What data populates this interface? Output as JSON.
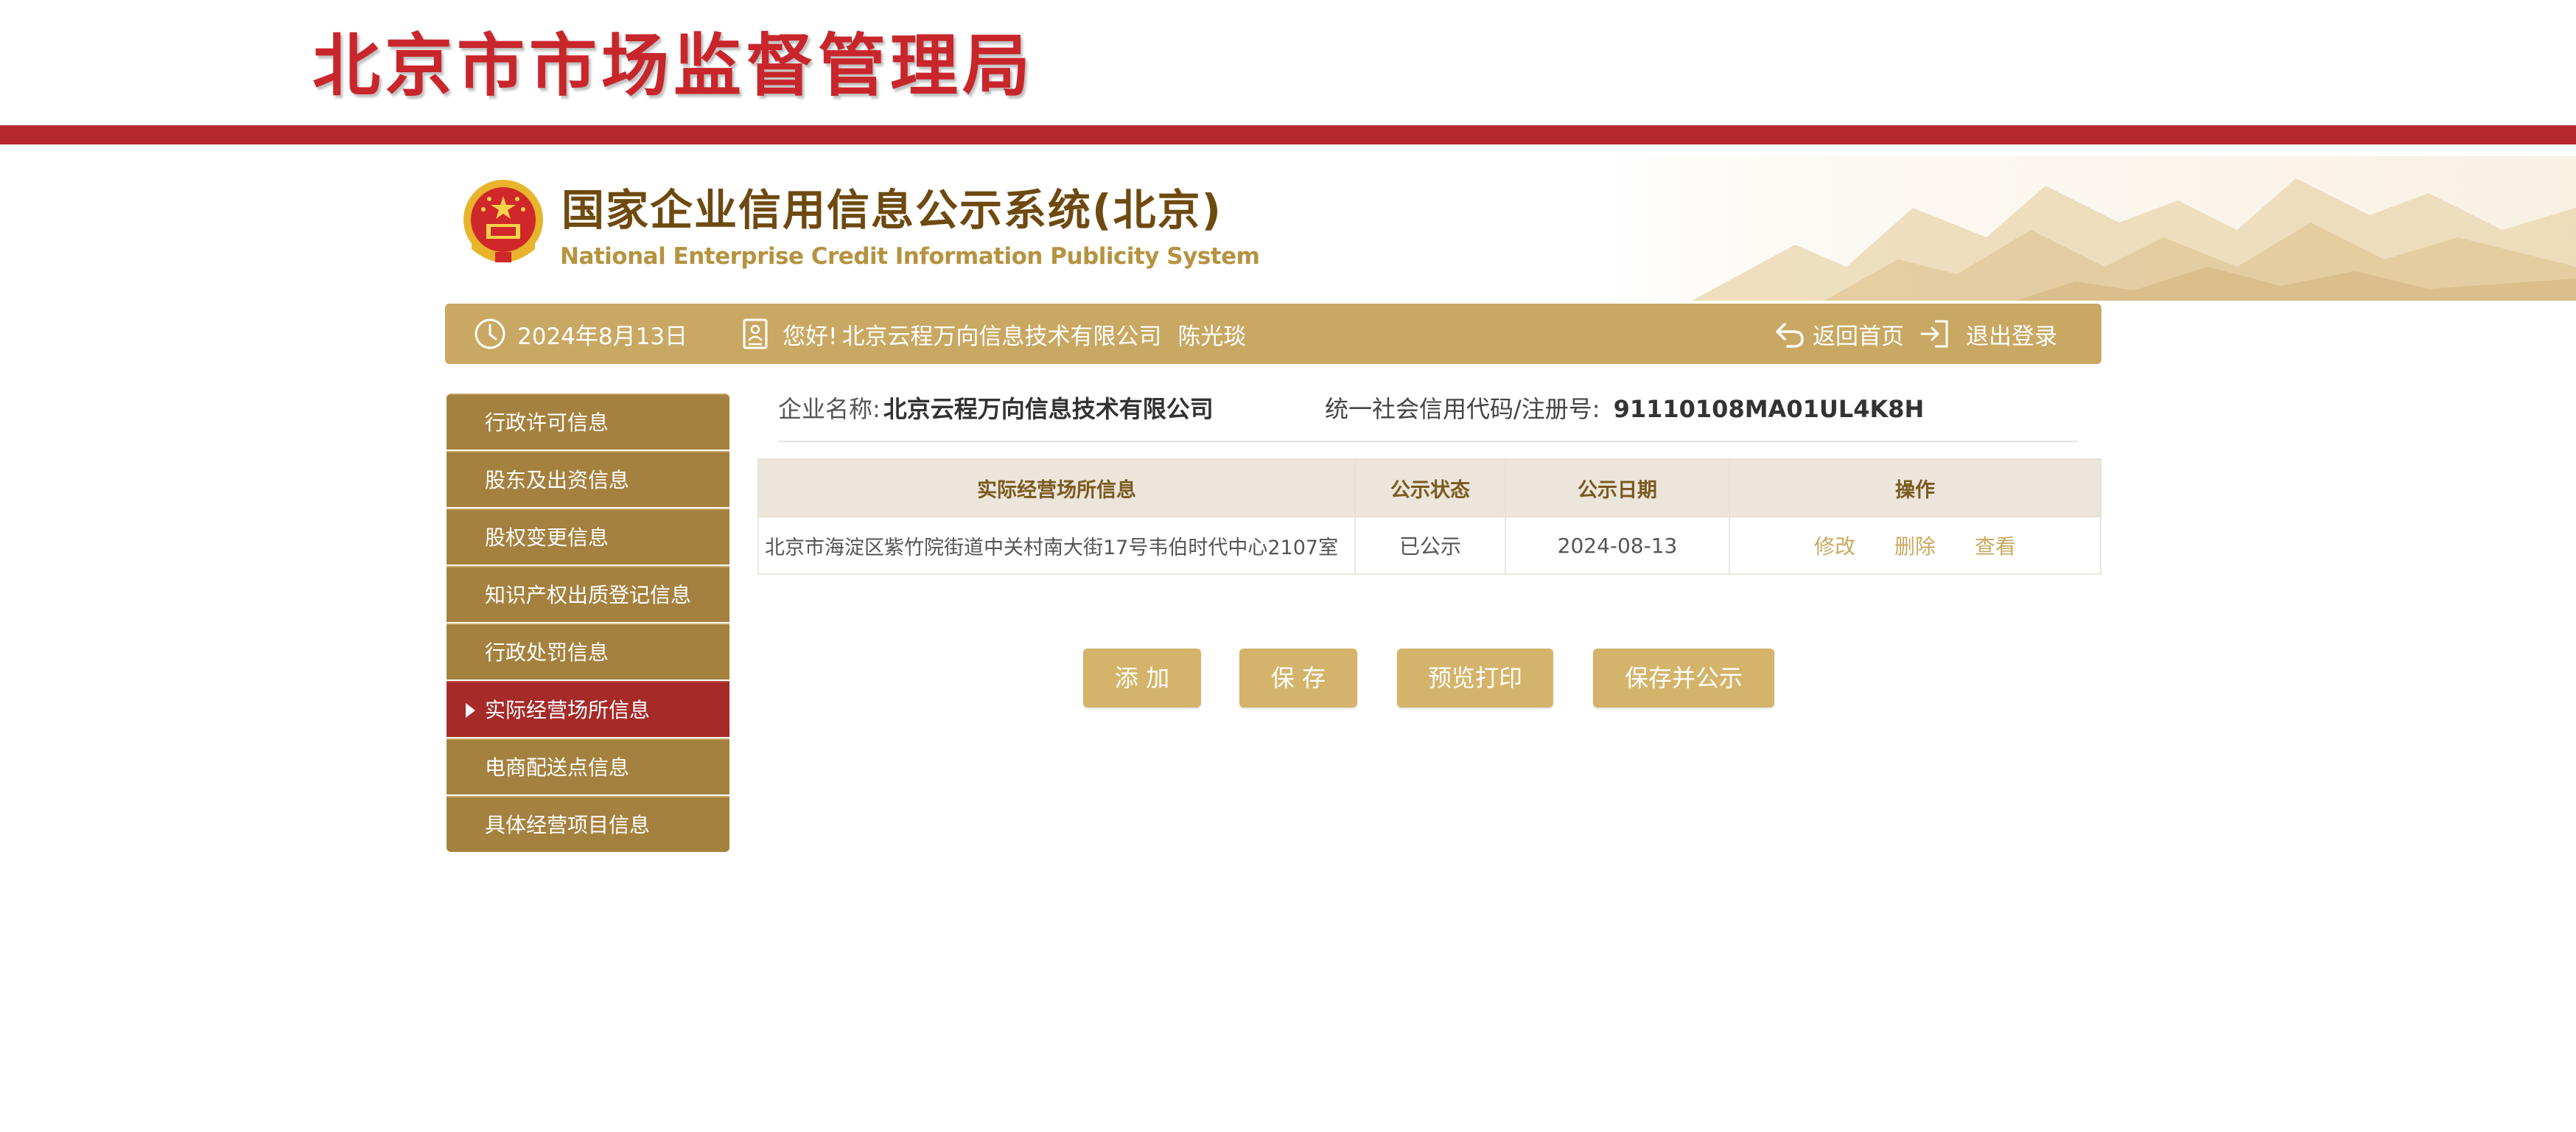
{
  "header": {
    "bureau_title": "北京市市场监督管理局",
    "system_title_cn": "国家企业信用信息公示系统(北京)",
    "system_title_en": "National Enterprise Credit Information Publicity System"
  },
  "info_bar": {
    "date": "2024年8月13日",
    "greeting": "您好!",
    "company": "北京云程万向信息技术有限公司",
    "user": "陈光琰",
    "home_label": "返回首页",
    "logout_label": "退出登录"
  },
  "sidebar": {
    "items": [
      {
        "label": "行政许可信息"
      },
      {
        "label": "股东及出资信息"
      },
      {
        "label": "股权变更信息"
      },
      {
        "label": "知识产权出质登记信息"
      },
      {
        "label": "行政处罚信息"
      },
      {
        "label": "实际经营场所信息",
        "active": true
      },
      {
        "label": "电商配送点信息"
      },
      {
        "label": "具体经营项目信息"
      }
    ]
  },
  "company_info": {
    "name_label": "企业名称:",
    "name_value": "北京云程万向信息技术有限公司",
    "code_label": "统一社会信用代码/注册号:",
    "code_value": "91110108MA01UL4K8H"
  },
  "table": {
    "headers": [
      "实际经营场所信息",
      "公示状态",
      "公示日期",
      "操作"
    ],
    "rows": [
      {
        "address": "北京市海淀区紫竹院街道中关村南大街17号韦伯时代中心2107室",
        "status": "已公示",
        "date": "2024-08-13",
        "ops": [
          "修改",
          "删除",
          "查看"
        ]
      }
    ]
  },
  "buttons": {
    "add": "添 加",
    "save": "保 存",
    "preview_print": "预览打印",
    "save_publish": "保存并公示"
  },
  "colors": {
    "brand_red": "#b5272c",
    "gold_bar": "#c9a863",
    "sidebar_gold": "#a5813f",
    "sidebar_active": "#a52a28",
    "button_gold": "#d4b46b",
    "link_gold": "#c9a95f"
  },
  "icons": {
    "clock": "clock-icon",
    "user_card": "user-badge-icon",
    "home": "return-home-icon",
    "logout": "logout-icon",
    "emblem": "national-emblem-icon"
  }
}
